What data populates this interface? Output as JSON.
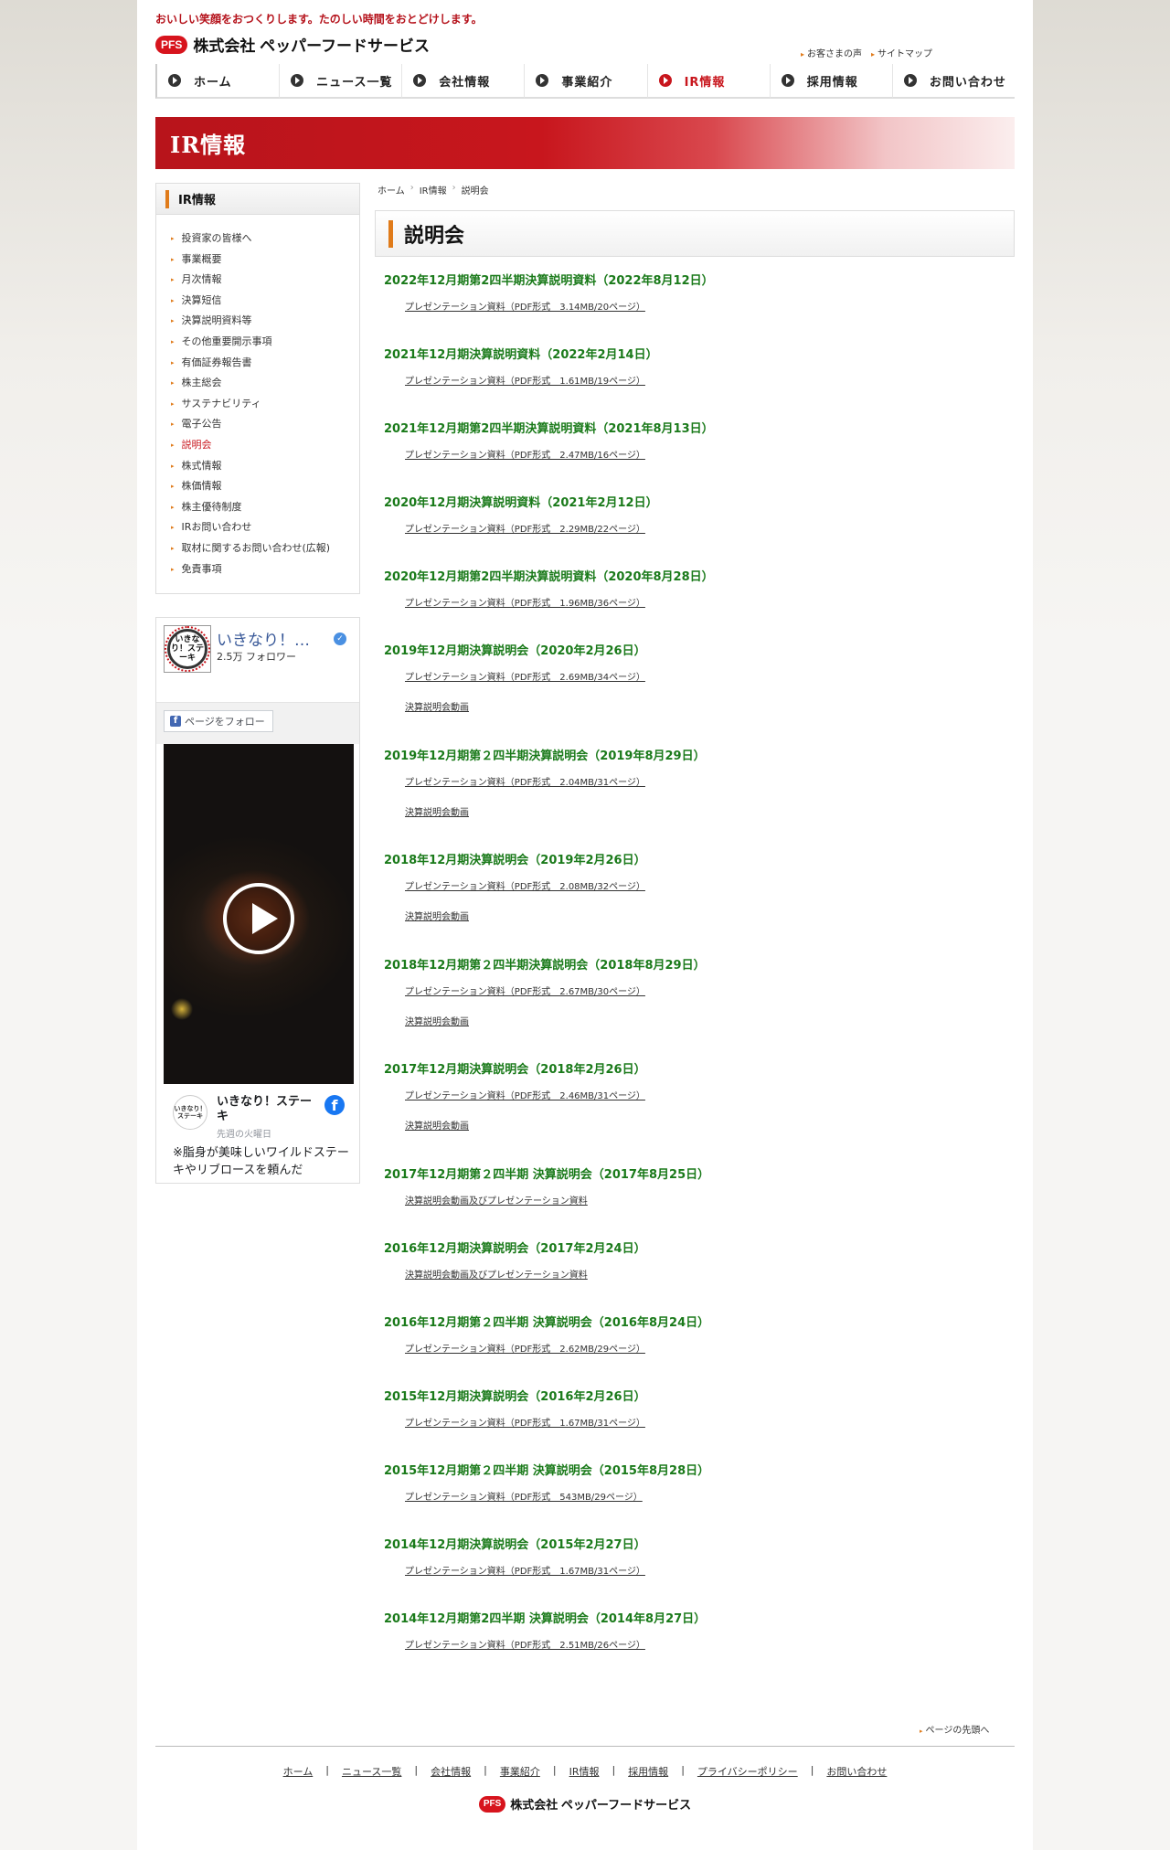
{
  "header": {
    "tagline": "おいしい笑顔をおつくりします。たのしい時間をおとどけします。",
    "logo_badge": "PFS",
    "company_name": "株式会社 ペッパーフードサービス",
    "util_links": [
      "お客さまの声",
      "サイトマップ"
    ]
  },
  "nav": {
    "items": [
      "ホーム",
      "ニュース一覧",
      "会社情報",
      "事業紹介",
      "IR情報",
      "採用情報",
      "お問い合わせ"
    ],
    "active": "IR情報"
  },
  "banner": {
    "title": "IR情報"
  },
  "sidebar": {
    "heading": "IR情報",
    "items": [
      "投資家の皆様へ",
      "事業概要",
      "月次情報",
      "決算短信",
      "決算説明資料等",
      "その他重要開示事項",
      "有価証券報告書",
      "株主総会",
      "サステナビリティ",
      "電子公告",
      "説明会",
      "株式情報",
      "株価情報",
      "株主優待制度",
      "IRお問い合わせ",
      "取材に関するお問い合わせ(広報)",
      "免責事項"
    ],
    "current": "説明会"
  },
  "facebook": {
    "page_name": "いきなり！…",
    "followers": "2.5万 フォロワー",
    "follow_button": "ページをフォロー",
    "avatar_text": "いきなり！ステーキ",
    "post_author": "いきなり！ステーキ",
    "post_date": "先週の火曜日",
    "post_text": "※脂身が美味しいワイルドステーキやリブロースを頼んだ"
  },
  "breadcrumb": [
    "ホーム",
    "IR情報",
    "説明会"
  ],
  "page_title": "説明会",
  "sessions": [
    {
      "title": "2022年12月期第2四半期決算説明資料（2022年8月12日）",
      "links": [
        "プレゼンテーション資料（PDF形式　3.14MB/20ページ）"
      ]
    },
    {
      "title": "2021年12月期決算説明資料（2022年2月14日）",
      "links": [
        "プレゼンテーション資料（PDF形式　1.61MB/19ページ）"
      ]
    },
    {
      "title": "2021年12月期第2四半期決算説明資料（2021年8月13日）",
      "links": [
        "プレゼンテーション資料（PDF形式　2.47MB/16ページ）"
      ]
    },
    {
      "title": "2020年12月期決算説明資料（2021年2月12日）",
      "links": [
        "プレゼンテーション資料（PDF形式　2.29MB/22ページ）"
      ]
    },
    {
      "title": "2020年12月期第2四半期決算説明資料（2020年8月28日）",
      "links": [
        "プレゼンテーション資料（PDF形式　1.96MB/36ページ）"
      ]
    },
    {
      "title": "2019年12月期決算説明会（2020年2月26日）",
      "links": [
        "プレゼンテーション資料（PDF形式　2.69MB/34ページ）",
        "決算説明会動画"
      ]
    },
    {
      "title": "2019年12月期第２四半期決算説明会（2019年8月29日）",
      "links": [
        "プレゼンテーション資料（PDF形式　2.04MB/31ページ）",
        "決算説明会動画"
      ]
    },
    {
      "title": "2018年12月期決算説明会（2019年2月26日）",
      "links": [
        "プレゼンテーション資料（PDF形式　2.08MB/32ページ）",
        "決算説明会動画"
      ]
    },
    {
      "title": "2018年12月期第２四半期決算説明会（2018年8月29日）",
      "links": [
        "プレゼンテーション資料（PDF形式　2.67MB/30ページ）",
        "決算説明会動画"
      ]
    },
    {
      "title": "2017年12月期決算説明会（2018年2月26日）",
      "links": [
        "プレゼンテーション資料（PDF形式　2.46MB/31ページ）",
        "決算説明会動画"
      ]
    },
    {
      "title": "2017年12月期第２四半期 決算説明会（2017年8月25日）",
      "links": [
        "決算説明会動画及びプレゼンテーション資料"
      ]
    },
    {
      "title": "2016年12月期決算説明会（2017年2月24日）",
      "links": [
        "決算説明会動画及びプレゼンテーション資料"
      ]
    },
    {
      "title": "2016年12月期第２四半期 決算説明会（2016年8月24日）",
      "links": [
        "プレゼンテーション資料（PDF形式　2.62MB/29ページ）"
      ]
    },
    {
      "title": "2015年12月期決算説明会（2016年2月26日）",
      "links": [
        "プレゼンテーション資料（PDF形式　1.67MB/31ページ）"
      ]
    },
    {
      "title": "2015年12月期第２四半期 決算説明会（2015年8月28日）",
      "links": [
        "プレゼンテーション資料（PDF形式　543MB/29ページ）"
      ]
    },
    {
      "title": "2014年12月期決算説明会（2015年2月27日）",
      "links": [
        "プレゼンテーション資料（PDF形式　1.67MB/31ページ）"
      ]
    },
    {
      "title": "2014年12月期第2四半期 決算説明会（2014年8月27日）",
      "links": [
        "プレゼンテーション資料（PDF形式　2.51MB/26ページ）"
      ]
    }
  ],
  "page_top": "ページの先頭へ",
  "footer": {
    "links": [
      "ホーム",
      "ニュース一覧",
      "会社情報",
      "事業紹介",
      "IR情報",
      "採用情報",
      "プライバシーポリシー",
      "お問い合わせ"
    ],
    "logo_badge": "PFS",
    "company_name": "株式会社 ペッパーフードサービス"
  },
  "colors": {
    "brand_red": "#c8161d",
    "accent_orange": "#e07b1a",
    "session_title_green": "#1a7a1a"
  }
}
